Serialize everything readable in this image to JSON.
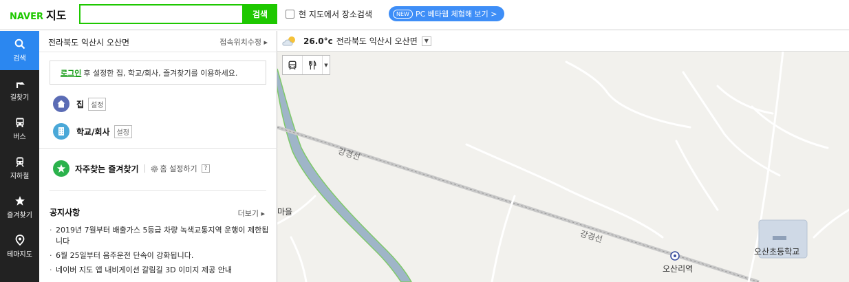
{
  "header": {
    "logo_brand": "NAVER",
    "logo_service": "지도",
    "search_value": "",
    "search_button": "검색",
    "area_search_label": "현 지도에서 장소검색",
    "beta_badge": "NEW",
    "beta_label": "PC 베타웹 체험해 보기 >"
  },
  "left_nav": {
    "items": [
      {
        "label": "검색",
        "icon": "search-icon",
        "active": true
      },
      {
        "label": "길찾기",
        "icon": "directions-icon"
      },
      {
        "label": "버스",
        "icon": "bus-icon"
      },
      {
        "label": "지하철",
        "icon": "subway-icon"
      },
      {
        "label": "즐겨찾기",
        "icon": "star-icon"
      },
      {
        "label": "테마지도",
        "icon": "pin-icon"
      }
    ]
  },
  "panel": {
    "location": "전라북도 익산시 오산면",
    "location_fix": "접속위치수정 ▸",
    "login_link": "로그인",
    "login_text": "후 설정한 집, 학교/회사, 즐겨찾기를 이용하세요.",
    "home_label": "집",
    "home_tag": "설정",
    "work_label": "학교/회사",
    "work_tag": "설정",
    "favorites_label": "자주찾는 즐겨찾기",
    "home_settings": "홈 설정하기",
    "help": "?",
    "notice_title": "공지사항",
    "notice_more": "더보기 ▸",
    "notices": [
      "2019년 7월부터 배출가스 5등급 차량 녹색교통지역 운행이 제한됩니다",
      "6월 25일부터 음주운전 단속이 강화됩니다.",
      "네이버 지도 앱 내비게이션 갈림길 3D 이미지 제공 안내"
    ]
  },
  "map": {
    "weather_temp": "26.0°c",
    "weather_location": "전라북도 익산시 오산면",
    "labels": {
      "road1": "강경선",
      "road2": "강경선",
      "village": "마을",
      "station": "오산리역",
      "school": "오산초등학교"
    }
  },
  "colors": {
    "brand_green": "#1ec800",
    "nav_active": "#2b87f0",
    "nav_bg": "#222222",
    "beta_blue": "#3e8ef7"
  }
}
